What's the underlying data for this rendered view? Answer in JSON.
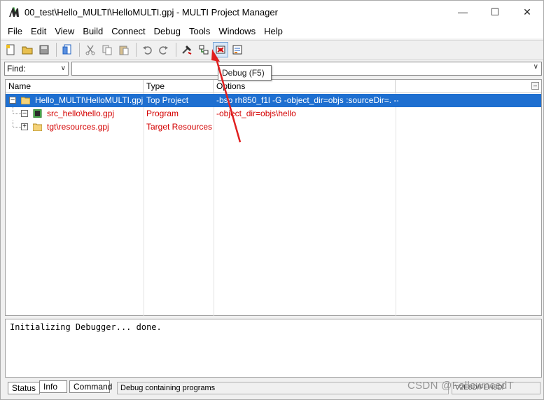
{
  "window": {
    "title": "00_test\\Hello_MULTI\\HelloMULTI.gpj - MULTI Project Manager",
    "minimize": "—",
    "maximize": "☐",
    "close": "✕"
  },
  "menu": [
    "File",
    "Edit",
    "View",
    "Build",
    "Connect",
    "Debug",
    "Tools",
    "Windows",
    "Help"
  ],
  "find": {
    "label": "Find:",
    "value": ""
  },
  "tooltip": "Debug (F5)",
  "tree": {
    "columns": [
      "Name",
      "Type",
      "Options"
    ],
    "rows": [
      {
        "name": "Hello_MULTI\\HelloMULTI.gpj",
        "type": "Top Project",
        "options": "-bsp rh850_f1l -G -object_dir=objs :sourceDir=. --ee",
        "icon": "folder-icon",
        "selected": true
      },
      {
        "name": "src_hello\\hello.gpj",
        "type": "Program",
        "options": "-object_dir=objs\\hello",
        "icon": "program-icon",
        "selected": false
      },
      {
        "name": "tgt\\resources.gpj",
        "type": "Target Resources",
        "options": "",
        "icon": "folder-icon",
        "selected": false
      }
    ]
  },
  "output": "Initializing Debugger... done.",
  "tabs": [
    "Status",
    "Info",
    "Command"
  ],
  "status": {
    "message": "Debug containing programs",
    "right": "V2E8D/FEH8D/"
  },
  "watermark": "CSDN @FollowncedT",
  "colors": {
    "selection": "#1e6fd0",
    "red_text": "#d40000",
    "annotation_arrow": "#e02020"
  }
}
